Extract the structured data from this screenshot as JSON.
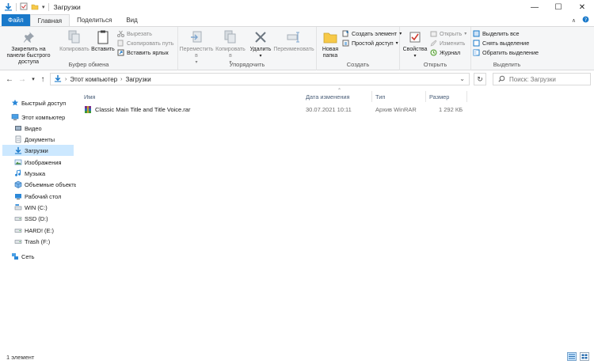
{
  "window": {
    "title": "Загрузки",
    "minimize": "—",
    "maximize": "☐",
    "close": "✕"
  },
  "tabs": {
    "file": "Файл",
    "home": "Главная",
    "share": "Поделиться",
    "view": "Вид"
  },
  "ribbon": {
    "clipboard": {
      "label": "Буфер обмена",
      "pin": "Закрепить на панели быстрого доступа",
      "copy": "Копировать",
      "paste": "Вставить",
      "cut": "Вырезать",
      "copy_path": "Скопировать путь",
      "paste_shortcut": "Вставить ярлык"
    },
    "organize": {
      "label": "Упорядочить",
      "move_to": "Переместить в",
      "copy_to": "Копировать в",
      "delete": "Удалить",
      "rename": "Переименовать"
    },
    "create": {
      "label": "Создать",
      "new_folder": "Новая папка",
      "new_item": "Создать элемент",
      "easy_access": "Простой доступ"
    },
    "open": {
      "label": "Открыть",
      "properties": "Свойства",
      "open": "Открыть",
      "edit": "Изменить",
      "history": "Журнал"
    },
    "select": {
      "label": "Выделить",
      "select_all": "Выделить все",
      "select_none": "Снять выделение",
      "invert": "Обратить выделение"
    }
  },
  "address": {
    "segments": [
      "Этот компьютер",
      "Загрузки"
    ],
    "search_placeholder": "Поиск: Загрузки"
  },
  "nav": [
    {
      "label": "Быстрый доступ",
      "icon": "star-icon"
    },
    {
      "label": "Этот компьютер",
      "icon": "computer-icon"
    },
    {
      "label": "Видео",
      "icon": "video-icon"
    },
    {
      "label": "Документы",
      "icon": "document-icon"
    },
    {
      "label": "Загрузки",
      "icon": "download-icon"
    },
    {
      "label": "Изображения",
      "icon": "image-icon"
    },
    {
      "label": "Музыка",
      "icon": "music-icon"
    },
    {
      "label": "Объемные объекты",
      "icon": "3d-objects-icon"
    },
    {
      "label": "Рабочий стол",
      "icon": "desktop-icon"
    },
    {
      "label": "WIN (C:)",
      "icon": "drive-icon"
    },
    {
      "label": "SSD (D:)",
      "icon": "drive-icon"
    },
    {
      "label": "HARD! (E:)",
      "icon": "drive-icon"
    },
    {
      "label": "Trash (F:)",
      "icon": "drive-icon"
    },
    {
      "label": "Сеть",
      "icon": "network-icon"
    }
  ],
  "columns": {
    "name": "Имя",
    "date": "Дата изменения",
    "type": "Тип",
    "size": "Размер"
  },
  "files": [
    {
      "name": "Classic Main Title and Title Voice.rar",
      "date": "30.07.2021 10:11",
      "type": "Архив WinRAR",
      "size": "1 292 КБ"
    }
  ],
  "status": {
    "count": "1 элемент"
  },
  "colors": {
    "accent": "#1979ca",
    "selection": "#cce8ff",
    "folder": "#f7c948"
  }
}
